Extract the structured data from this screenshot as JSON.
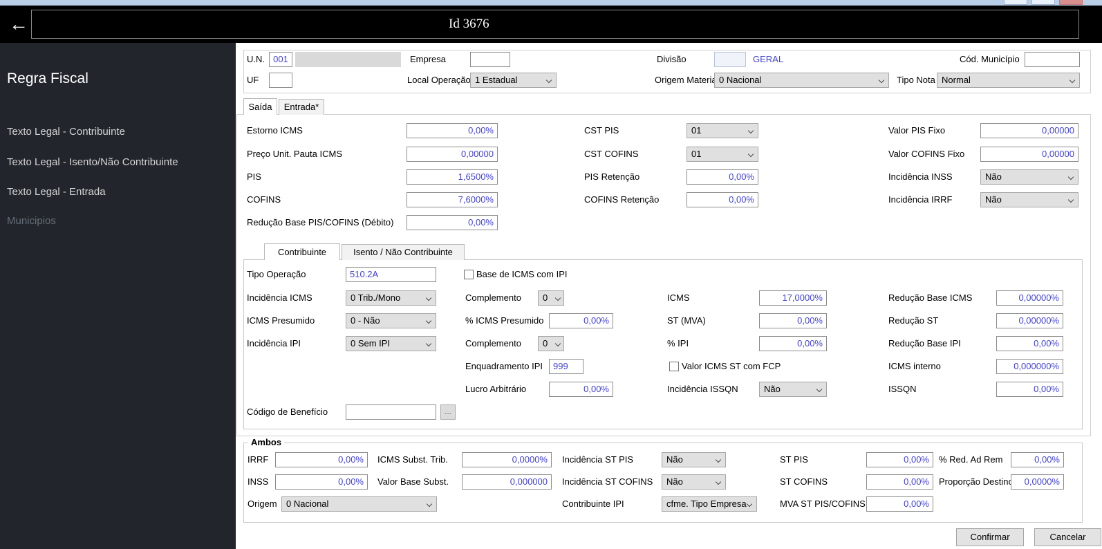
{
  "colors": {
    "titlebar_bg": "#b9cfe8",
    "header_bg": "#000000",
    "sidebar_bg": "#22262c",
    "value_text": "#4343cf"
  },
  "header": {
    "back_icon": "←",
    "title": "Id 3676"
  },
  "sidebar": {
    "title": "Regra Fiscal",
    "items": [
      {
        "label": "Texto Legal - Contribuinte",
        "enabled": true
      },
      {
        "label": "Texto Legal - Isento/Não Contribuinte",
        "enabled": true
      },
      {
        "label": "Texto Legal - Entrada",
        "enabled": true
      },
      {
        "label": "Municipios",
        "enabled": false
      }
    ]
  },
  "topform": {
    "un": {
      "label": "U.N.",
      "value": "001"
    },
    "empresa": {
      "label": "Empresa",
      "value": ""
    },
    "divisao": {
      "label": "Divisão",
      "value": "",
      "text": "GERAL"
    },
    "cod_municipio": {
      "label": "Cód. Município",
      "value": ""
    },
    "uf": {
      "label": "UF",
      "value": ""
    },
    "local_operacao": {
      "label": "Local Operação",
      "value": "1 Estadual"
    },
    "origem_material": {
      "label": "Origem Material",
      "value": "0 Nacional"
    },
    "tipo_nota": {
      "label": "Tipo Nota",
      "value": "Normal"
    }
  },
  "tabs": {
    "saida": "Saída",
    "entrada": "Entrada*"
  },
  "saida": {
    "estorno_icms": {
      "label": "Estorno ICMS",
      "value": "0,00%"
    },
    "preco_pauta": {
      "label": "Preço Unit. Pauta ICMS",
      "value": "0,00000"
    },
    "pis": {
      "label": "PIS",
      "value": "1,6500%"
    },
    "cofins": {
      "label": "COFINS",
      "value": "7,6000%"
    },
    "reducao_pis_cofins": {
      "label": "Redução Base PIS/COFINS (Débito)",
      "value": "0,00%"
    },
    "cst_pis": {
      "label": "CST PIS",
      "value": "01"
    },
    "cst_cofins": {
      "label": "CST COFINS",
      "value": "01"
    },
    "pis_retencao": {
      "label": "PIS Retenção",
      "value": "0,00%"
    },
    "cofins_retencao": {
      "label": "COFINS Retenção",
      "value": "0,00%"
    },
    "valor_pis_fixo": {
      "label": "Valor PIS Fixo",
      "value": "0,00000"
    },
    "valor_cofins_fixo": {
      "label": "Valor COFINS Fixo",
      "value": "0,00000"
    },
    "incidencia_inss": {
      "label": "Incidência INSS",
      "value": "Não"
    },
    "incidencia_irrf": {
      "label": "Incidência IRRF",
      "value": "Não"
    }
  },
  "inner_tabs": {
    "contribuinte": "Contribuinte",
    "isento": "Isento / Não Contribuinte"
  },
  "contribuinte": {
    "tipo_operacao": {
      "label": "Tipo Operação",
      "value": "510.2A"
    },
    "base_icms_ipi": {
      "label": "Base de ICMS com IPI",
      "checked": false
    },
    "incidencia_icms": {
      "label": "Incidência ICMS",
      "value": "0 Trib./Mono"
    },
    "complemento_icms": {
      "label": "Complemento",
      "value": "0"
    },
    "icms": {
      "label": "ICMS",
      "value": "17,0000%"
    },
    "reducao_base_icms": {
      "label": "Redução Base ICMS",
      "value": "0,00000%"
    },
    "icms_presumido": {
      "label": "ICMS Presumido",
      "value": "0 - Não"
    },
    "pct_icms_presumido": {
      "label": "% ICMS Presumido",
      "value": "0,00%"
    },
    "st_mva": {
      "label": "ST (MVA)",
      "value": "0,00%"
    },
    "reducao_st": {
      "label": "Redução ST",
      "value": "0,00000%"
    },
    "incidencia_ipi": {
      "label": "Incidência IPI",
      "value": "0 Sem IPI"
    },
    "complemento_ipi": {
      "label": "Complemento",
      "value": "0"
    },
    "pct_ipi": {
      "label": "% IPI",
      "value": "0,00%"
    },
    "reducao_base_ipi": {
      "label": "Redução Base IPI",
      "value": "0,00%"
    },
    "enquadramento_ipi": {
      "label": "Enquadramento IPI",
      "value": "999"
    },
    "valor_icms_st_fcp": {
      "label": "Valor ICMS ST com FCP",
      "checked": false
    },
    "icms_interno": {
      "label": "ICMS interno",
      "value": "0,000000%"
    },
    "lucro_arbitrario": {
      "label": "Lucro Arbitrário",
      "value": "0,00%"
    },
    "incidencia_issqn": {
      "label": "Incidência ISSQN",
      "value": "Não"
    },
    "issqn": {
      "label": "ISSQN",
      "value": "0,00%"
    },
    "codigo_beneficio": {
      "label": "Código de Benefício",
      "value": "",
      "browse": "..."
    }
  },
  "ambos": {
    "title": "Ambos",
    "irrf": {
      "label": "IRRF",
      "value": "0,00%"
    },
    "inss": {
      "label": "INSS",
      "value": "0,00%"
    },
    "origem": {
      "label": "Origem",
      "value": "0 Nacional"
    },
    "icms_subst_trib": {
      "label": "ICMS Subst. Trib.",
      "value": "0,0000%"
    },
    "valor_base_subst": {
      "label": "Valor Base Subst.",
      "value": "0,000000"
    },
    "incidencia_st_pis": {
      "label": "Incidência ST PIS",
      "value": "Não"
    },
    "incidencia_st_cofins": {
      "label": "Incidência ST COFINS",
      "value": "Não"
    },
    "contribuinte_ipi": {
      "label": "Contribuinte IPI",
      "value": "cfme. Tipo Empresa"
    },
    "st_pis": {
      "label": "ST PIS",
      "value": "0,00%"
    },
    "st_cofins": {
      "label": "ST COFINS",
      "value": "0,00%"
    },
    "mva_st_pis_cofins": {
      "label": "MVA ST PIS/COFINS",
      "value": "0,00%"
    },
    "pct_red_ad_rem": {
      "label": "% Red. Ad Rem",
      "value": "0,00%"
    },
    "proporcao_destino": {
      "label": "Proporção Destino",
      "value": "0,0000%"
    }
  },
  "actions": {
    "confirm": "Confirmar",
    "cancel": "Cancelar"
  }
}
